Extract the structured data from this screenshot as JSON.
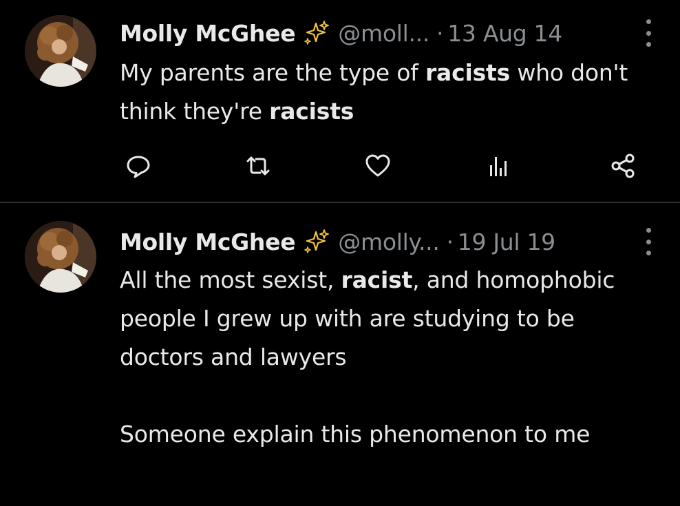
{
  "tweets": [
    {
      "display_name": "Molly McGhee",
      "handle": "@moll...",
      "separator": "·",
      "date": "13 Aug 14",
      "text_parts": [
        {
          "t": "My parents are the type of ",
          "b": false
        },
        {
          "t": "racists",
          "b": true
        },
        {
          "t": " who don't think they're ",
          "b": false
        },
        {
          "t": "racists",
          "b": true
        }
      ],
      "actions": [
        "reply-icon",
        "retweet-icon",
        "like-icon",
        "views-icon",
        "share-icon"
      ]
    },
    {
      "display_name": "Molly McGhee",
      "handle": "@molly...",
      "separator": "·",
      "date": "19 Jul 19",
      "text_parts": [
        {
          "t": "All the most sexist, ",
          "b": false
        },
        {
          "t": "racist",
          "b": true
        },
        {
          "t": ", and homophobic people I grew up with are studying to be doctors and lawyers",
          "b": false
        }
      ],
      "text_para2": "Someone explain this phenomenon to me"
    }
  ],
  "colors": {
    "background": "#000000",
    "text": "#e7e9ea",
    "secondary": "#8b8f94",
    "divider": "#2f3336",
    "sparkle": "#f5c542"
  }
}
